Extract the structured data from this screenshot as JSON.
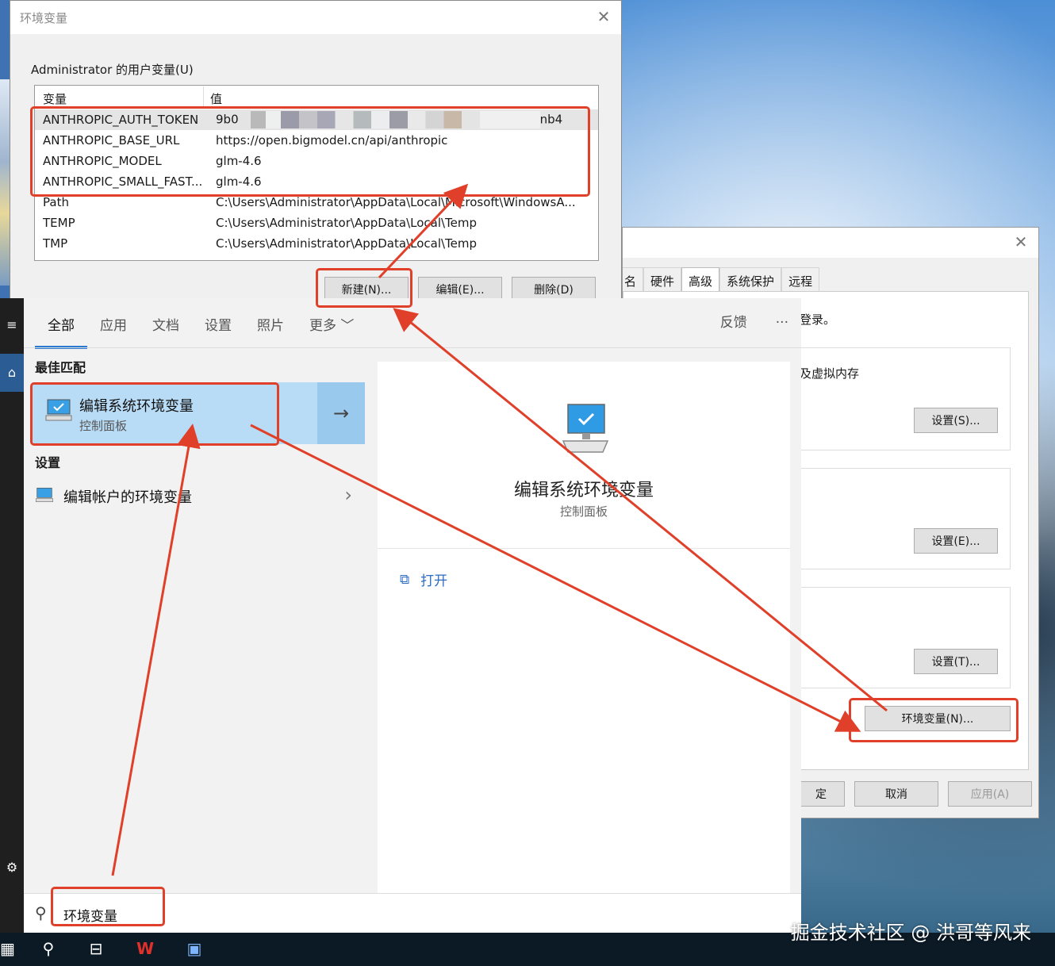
{
  "env_dialog": {
    "title": "环境变量",
    "group_label": "Administrator 的用户变量(U)",
    "columns": {
      "name": "变量",
      "value": "值"
    },
    "rows": [
      {
        "name": "ANTHROPIC_AUTH_TOKEN",
        "value_start": "9b0",
        "value_end": "nb4"
      },
      {
        "name": "ANTHROPIC_BASE_URL",
        "value": "https://open.bigmodel.cn/api/anthropic"
      },
      {
        "name": "ANTHROPIC_MODEL",
        "value": "glm-4.6"
      },
      {
        "name": "ANTHROPIC_SMALL_FAST...",
        "value": "glm-4.6"
      },
      {
        "name": "Path",
        "value": "C:\\Users\\Administrator\\AppData\\Local\\Microsoft\\WindowsA..."
      },
      {
        "name": "TEMP",
        "value": "C:\\Users\\Administrator\\AppData\\Local\\Temp"
      },
      {
        "name": "TMP",
        "value": "C:\\Users\\Administrator\\AppData\\Local\\Temp"
      }
    ],
    "buttons": {
      "new": "新建(N)...",
      "edit": "编辑(E)...",
      "delete": "删除(D)"
    }
  },
  "sys_dialog": {
    "tabs": [
      "名",
      "硬件",
      "高级",
      "系统保护",
      "远程"
    ],
    "active_tab": "高级",
    "text_login": "登录。",
    "text_memory": "及虚拟内存",
    "buttons": {
      "perf_settings": "设置(S)...",
      "profile_settings": "设置(E)...",
      "startup_settings": "设置(T)...",
      "env_vars": "环境变量(N)...",
      "ok": "定",
      "cancel": "取消",
      "apply": "应用(A)"
    }
  },
  "search_panel": {
    "tabs": [
      "全部",
      "应用",
      "文档",
      "设置",
      "照片",
      "更多"
    ],
    "active_tab": "全部",
    "feedback": "反馈",
    "more_dots": "···",
    "best_match_heading": "最佳匹配",
    "best_match": {
      "title": "编辑系统环境变量",
      "subtitle": "控制面板"
    },
    "settings_heading": "设置",
    "settings_item": "编辑帐户的环境变量",
    "preview": {
      "title": "编辑系统环境变量",
      "subtitle": "控制面板",
      "open": "打开"
    },
    "query": "环境变量"
  },
  "watermark": "掘金技术社区 @ 洪哥等风来",
  "colors": {
    "highlight_red": "#e0402a",
    "accent_blue": "#2b79d0",
    "selected_bg": "#b9dcf6"
  }
}
